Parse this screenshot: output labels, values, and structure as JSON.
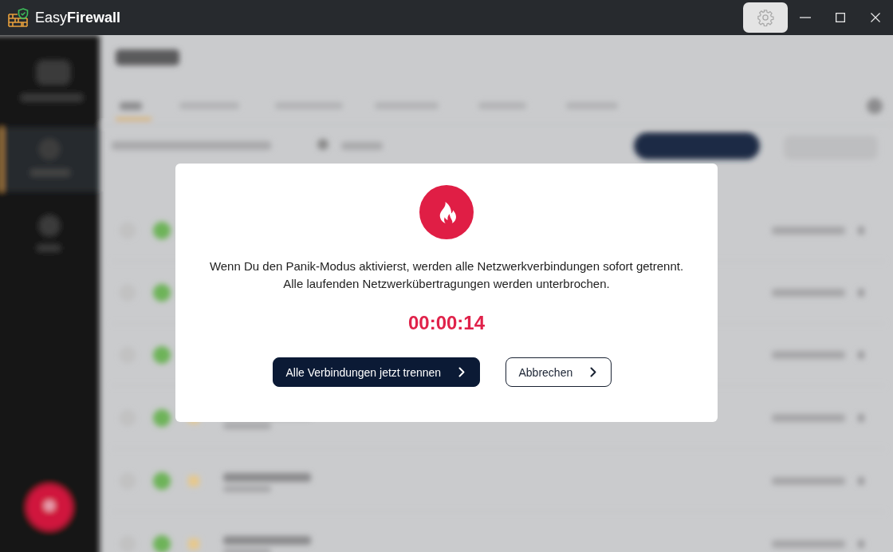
{
  "window": {
    "title": "Easy**Firewall**",
    "controls": [
      {
        "kind": "settings"
      },
      {
        "kind": "minimize"
      },
      {
        "kind": "maximize"
      },
      {
        "kind": "close"
      }
    ]
  },
  "dialog": {
    "message": [
      "Wenn Du den Panik-Modus aktivierst, werden alle Netzwerkverbindungen sofort getrennt.",
      "Alle laufenden Netzwerkübertragungen werden unterbrochen."
    ],
    "countdown": "00:00:14",
    "buttons": [
      {
        "label": "Alle Verbindungen jetzt trennen",
        "kind": "primary"
      },
      {
        "label": "Abbrechen",
        "kind": "secondary"
      }
    ]
  }
}
